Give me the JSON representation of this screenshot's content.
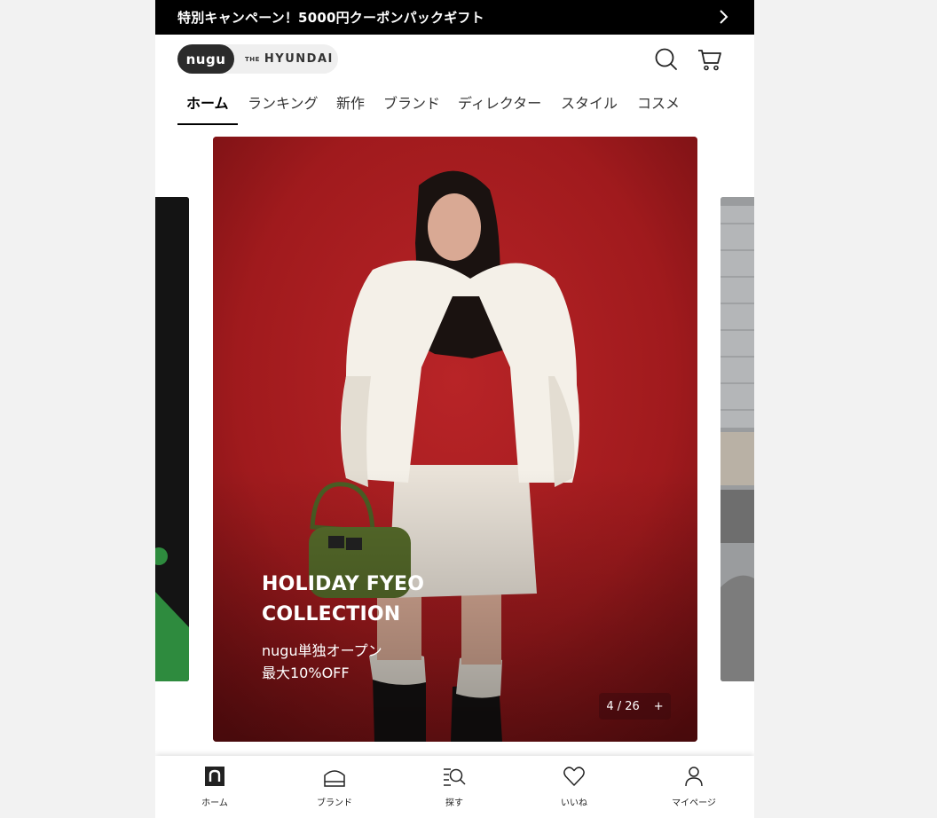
{
  "promo": {
    "text": "特別キャンペーン！5000円クーポンパックギフト"
  },
  "header": {
    "brand_active": "nugu",
    "brand_inactive_prefix": "THE",
    "brand_inactive": "HYUNDAI"
  },
  "nav": {
    "tabs": [
      {
        "label": "ホーム",
        "active": true
      },
      {
        "label": "ランキング"
      },
      {
        "label": "新作"
      },
      {
        "label": "ブランド"
      },
      {
        "label": "ディレクター"
      },
      {
        "label": "スタイル"
      },
      {
        "label": "コスメ"
      }
    ]
  },
  "hero": {
    "title_line1": "HOLIDAY FYEO",
    "title_line2": "COLLECTION",
    "sub_line1": "nugu単独オープン",
    "sub_line2": "最大10%OFF",
    "counter": "4 / 26",
    "counter_more": "+"
  },
  "bottom_nav": {
    "items": [
      {
        "label": "ホーム",
        "icon": "home-n-icon"
      },
      {
        "label": "ブランド",
        "icon": "store-icon"
      },
      {
        "label": "探す",
        "icon": "search-list-icon"
      },
      {
        "label": "いいね",
        "icon": "heart-icon"
      },
      {
        "label": "マイページ",
        "icon": "person-icon"
      }
    ]
  },
  "colors": {
    "hero_bg": "#a2191c",
    "promo_bg": "#000000",
    "brand_chip": "#2b2b2b"
  }
}
